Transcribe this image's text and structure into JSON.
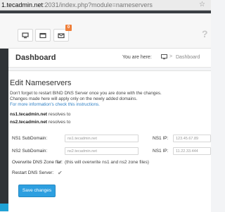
{
  "browser": {
    "url_host": "1.tecadmin.net",
    "url_path": ":2031/index.php?module=nameservers"
  },
  "toolbar": {
    "icons": [
      "monitor-icon",
      "window-icon",
      "mail-icon"
    ],
    "mail_badge": "0",
    "help_icon": "?"
  },
  "header": {
    "title": "Dashboard",
    "breadcrumb_label": "You are here:",
    "breadcrumb_separator": ">",
    "breadcrumb_current": "Dashboard"
  },
  "panel": {
    "title": "Edit Nameservers",
    "intro_line1": "Don't forget to restart BIND DNS Server once you are done with the changes.",
    "intro_line2": "Changes made here will apply only on the newly added domains.",
    "info_link": "For more information's check this instructions.",
    "ns1_host": "ns1.tecadmin.net",
    "ns1_suffix": " resolves to",
    "ns2_host": "ns2.tecadmin.net",
    "ns2_suffix": " resolves to"
  },
  "form": {
    "ns1_subdomain_label": "NS1 SubDomain:",
    "ns1_subdomain_value": "ns1.tecadmin.net",
    "ns1_ip_label": "NS1 IP:",
    "ns1_ip_value": "123.45.67.89",
    "ns2_subdomain_label": "NS2 SubDomain:",
    "ns2_subdomain_value": "ns2.tecadmin.net",
    "ns2_ip_label": "NS1 IP:",
    "ns2_ip_value": "11.22.33.444",
    "overwrite_label": "Overwrite DNS Zone file:",
    "overwrite_note": "(this will overwrite ns1 and ns2 zone files)",
    "restart_label": "Restart DNS Server:",
    "check_mark": "✔",
    "save_label": "Save changes"
  },
  "colors": {
    "accent": "#2d9fe0",
    "sidebar": "#2f3337",
    "link": "#2f80c5",
    "badge": "#ef7f3a"
  }
}
